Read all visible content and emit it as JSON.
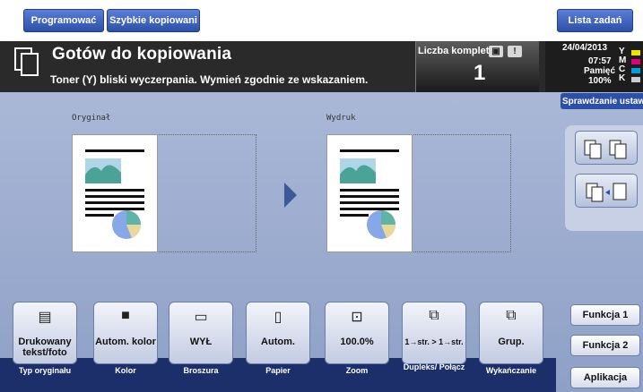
{
  "tabs": {
    "program": "Programować",
    "quick_copy": "Szybkie kopiowani",
    "jobs": "Lista zadań"
  },
  "header": {
    "title": "Gotów do kopiowania",
    "warning": "Toner (Y) bliski wyczerpania. Wymień zgodnie ze wskazaniem.",
    "copies_label": "Liczba komplet",
    "copies_value": "1"
  },
  "status": {
    "date": "24/04/2013",
    "time": "07:57",
    "memory_label": "Pamięć",
    "memory_value": "100%",
    "toner": [
      {
        "letter": "Y",
        "color": "#f2e200"
      },
      {
        "letter": "M",
        "color": "#e0007a"
      },
      {
        "letter": "C",
        "color": "#00a0e0"
      },
      {
        "letter": "K",
        "color": "#cccccc"
      }
    ],
    "check_button": "Sprawdzanie ustaw"
  },
  "preview": {
    "original_label": "Oryginał",
    "output_label": "Wydruk"
  },
  "functions": [
    {
      "name": "original-type",
      "label": "Drukowany tekst/foto",
      "caption": "Typ oryginału",
      "icon": "text-photo-icon"
    },
    {
      "name": "color",
      "label": "Autom. kolor",
      "caption": "Kolor",
      "icon": "auto-color-icon"
    },
    {
      "name": "booklet",
      "label": "WYŁ",
      "caption": "Broszura",
      "icon": "booklet-icon"
    },
    {
      "name": "paper",
      "label": "Autom.",
      "caption": "Papier",
      "icon": "paper-icon"
    },
    {
      "name": "zoom",
      "label": "100.0%",
      "caption": "Zoom",
      "icon": "zoom-icon"
    },
    {
      "name": "duplex",
      "label": "1→str. > 1→str.",
      "caption": "Dupleks/ Połącz",
      "icon": "duplex-icon"
    },
    {
      "name": "finishing",
      "label": "Grup.",
      "caption": "Wykańczanie",
      "icon": "group-icon"
    }
  ],
  "right_menu": {
    "func1": "Funkcja 1",
    "func2": "Funkcja 2",
    "app": "Aplikacja"
  }
}
